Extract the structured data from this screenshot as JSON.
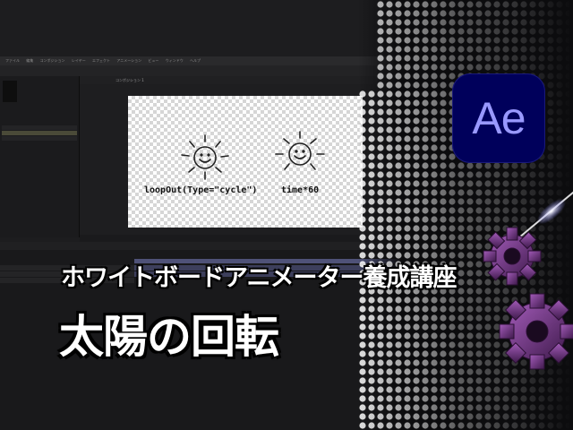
{
  "menubar": {
    "items": [
      "ファイル",
      "編集",
      "コンポジション",
      "レイヤー",
      "エフェクト",
      "アニメーション",
      "ビュー",
      "ウィンドウ",
      "ヘルプ"
    ]
  },
  "comp_tab": {
    "label": "コンポジション 1"
  },
  "canvas": {
    "expression_left": "loopOut(Type=\"cycle\")",
    "expression_right": "time*60"
  },
  "logo": {
    "text": "Ae",
    "bg": "#00005b",
    "fg": "#9999ff"
  },
  "title": {
    "line1": "ホワイトボードアニメーター養成講座",
    "line2": "太陽の回転"
  },
  "colors": {
    "accent": "#4f5278",
    "gear": "#7a3f8c"
  },
  "icons": [
    "sun-icon",
    "gear-icon",
    "ae-logo-icon"
  ]
}
